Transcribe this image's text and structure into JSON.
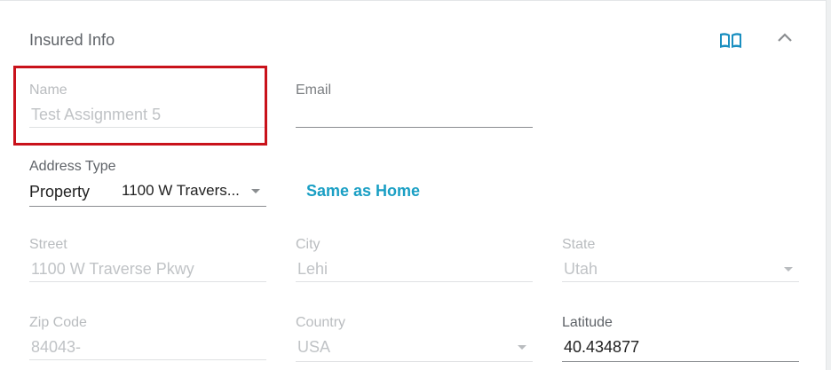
{
  "section": {
    "title": "Insured Info",
    "icons": [
      "book-icon",
      "chevron-up-icon"
    ]
  },
  "name": {
    "label": "Name",
    "value": "Test Assignment 5"
  },
  "email": {
    "label": "Email",
    "value": ""
  },
  "address_type": {
    "label": "Address Type",
    "type": "Property",
    "address": "1100 W Travers..."
  },
  "same_as_home": "Same as Home",
  "street": {
    "label": "Street",
    "value": "1100 W Traverse Pkwy"
  },
  "city": {
    "label": "City",
    "value": "Lehi"
  },
  "state": {
    "label": "State",
    "value": "Utah"
  },
  "zip": {
    "label": "Zip Code",
    "value": "84043-"
  },
  "country": {
    "label": "Country",
    "value": "USA"
  },
  "latitude": {
    "label": "Latitude",
    "value": "40.434877"
  },
  "colors": {
    "accent": "#1a9fc4",
    "highlight": "#c9121b",
    "icon": "#1a8fc0"
  }
}
